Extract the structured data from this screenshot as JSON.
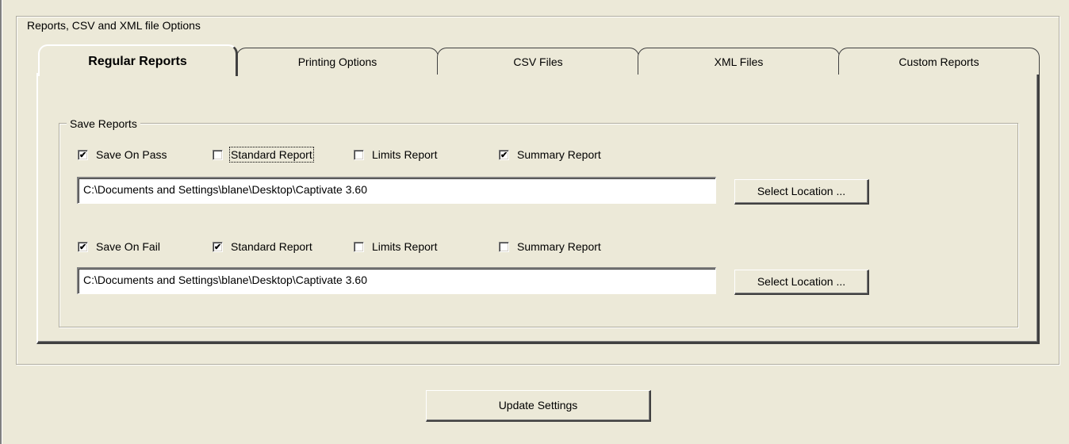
{
  "group_outer": {
    "label": "Reports, CSV and XML file Options"
  },
  "tabs": [
    {
      "label": "Regular Reports",
      "active": true
    },
    {
      "label": "Printing Options",
      "active": false
    },
    {
      "label": "CSV Files",
      "active": false
    },
    {
      "label": "XML Files",
      "active": false
    },
    {
      "label": "Custom Reports",
      "active": false
    }
  ],
  "save_reports": {
    "label": "Save Reports",
    "pass": {
      "save_on_pass": {
        "label": "Save On Pass",
        "checked": true
      },
      "standard_report": {
        "label": "Standard Report",
        "checked": false
      },
      "limits_report": {
        "label": "Limits Report",
        "checked": false
      },
      "summary_report": {
        "label": "Summary Report",
        "checked": true
      },
      "path": "C:\\Documents and Settings\\blane\\Desktop\\Captivate 3.60",
      "select_label": "Select Location ..."
    },
    "fail": {
      "save_on_fail": {
        "label": "Save On Fail",
        "checked": true
      },
      "standard_report": {
        "label": "Standard Report",
        "checked": true
      },
      "limits_report": {
        "label": "Limits Report",
        "checked": false
      },
      "summary_report": {
        "label": "Summary Report",
        "checked": false
      },
      "path": "C:\\Documents and Settings\\blane\\Desktop\\Captivate 3.60",
      "select_label": "Select Location ..."
    }
  },
  "update_button": {
    "label": "Update Settings"
  }
}
